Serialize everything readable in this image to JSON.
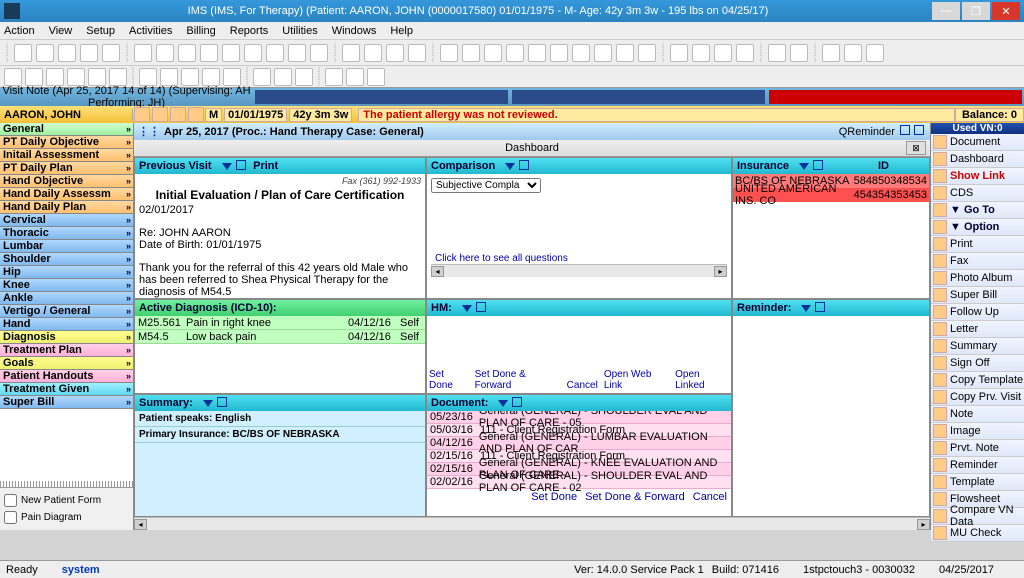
{
  "title": "IMS (IMS, For Therapy)    (Patient: AARON, JOHN  (0000017580) 01/01/1975 - M- Age: 42y 3m 3w - 195 lbs on 04/25/17)",
  "menu": [
    "Action",
    "View",
    "Setup",
    "Activities",
    "Billing",
    "Reports",
    "Utilities",
    "Windows",
    "Help"
  ],
  "visitHeader": "Visit Note (Apr 25, 2017   14 of 14)  (Supervising: AH Performing: JH)",
  "patient": {
    "name": "AARON, JOHN",
    "sex": "M",
    "dob": "01/01/1975",
    "age": "42y 3m 3w",
    "warn": "The patient allergy was not reviewed.",
    "balance": "Balance: 0"
  },
  "leftNav": [
    {
      "l": "General",
      "c": "c-green"
    },
    {
      "l": "PT Daily Objective",
      "c": "c-orange"
    },
    {
      "l": "Initail Assessment",
      "c": "c-orange"
    },
    {
      "l": "PT Daily Plan",
      "c": "c-orange"
    },
    {
      "l": "Hand Objective",
      "c": "c-orange"
    },
    {
      "l": "Hand Daily Assessm",
      "c": "c-orange"
    },
    {
      "l": "Hand Daily Plan",
      "c": "c-orange"
    },
    {
      "l": "Cervical",
      "c": "c-blue"
    },
    {
      "l": "Thoracic",
      "c": "c-blue"
    },
    {
      "l": "Lumbar",
      "c": "c-blue"
    },
    {
      "l": "Shoulder",
      "c": "c-blue"
    },
    {
      "l": "Hip",
      "c": "c-blue"
    },
    {
      "l": "Knee",
      "c": "c-blue"
    },
    {
      "l": "Ankle",
      "c": "c-blue"
    },
    {
      "l": "Vertigo / General",
      "c": "c-blue"
    },
    {
      "l": "Hand",
      "c": "c-blue"
    },
    {
      "l": "Diagnosis",
      "c": "c-yellow"
    },
    {
      "l": "Treatment Plan",
      "c": "c-pink"
    },
    {
      "l": "Goals",
      "c": "c-yellow"
    },
    {
      "l": "Patient Handouts",
      "c": "c-pink"
    },
    {
      "l": "Treatment Given",
      "c": "c-cyan"
    },
    {
      "l": "Super Bill",
      "c": "c-blue"
    }
  ],
  "leftChecks": [
    "New Patient Form",
    "Pain Diagram"
  ],
  "dateline": "Apr 25, 2017  (Proc.: Hand Therapy  Case: General)",
  "qreminder": "QReminder",
  "dashboard": "Dashboard",
  "panels": {
    "prev": {
      "hdr": "Previous Visit",
      "print": "Print",
      "fax": "Fax (361) 992-1933",
      "title": "Initial Evaluation / Plan of Care Certification",
      "date": "02/01/2017",
      "re": "Re: JOHN  AARON",
      "dob": "Date of Birth: 01/01/1975",
      "body": "Thank you for the referral of this 42 years old Male who has been referred to Shea Physical Therapy for the diagnosis of M54.5"
    },
    "cmp": {
      "hdr": "Comparison",
      "opt": "Subjective Compla",
      "link": "Click here to see all questions"
    },
    "ins": {
      "hdr": "Insurance",
      "idhdr": "ID",
      "rows": [
        [
          "BC/BS OF NEBRASKA",
          "584850348534"
        ],
        [
          "UNITED AMERICAN INS. CO",
          "454354353453"
        ]
      ]
    },
    "diag": {
      "hdr": "Active Diagnosis (ICD-10):",
      "rows": [
        [
          "M25.561",
          "Pain in right knee",
          "04/12/16",
          "Self"
        ],
        [
          "M54.5",
          "Low back pain",
          "04/12/16",
          "Self"
        ]
      ]
    },
    "hm": {
      "hdr": "HM:",
      "links": [
        "Set Done",
        "Set Done & Forward",
        "Cancel",
        "Open Web Link",
        "Open Linked"
      ]
    },
    "sum": {
      "hdr": "Summary:",
      "rows": [
        "Patient speaks: English",
        "Primary Insurance:  BC/BS OF NEBRASKA"
      ]
    },
    "doc": {
      "hdr": "Document:",
      "rows": [
        [
          "05/23/16",
          "General (GENERAL)  - SHOULDER EVAL AND PLAN OF CARE - 05"
        ],
        [
          "05/03/16",
          "111 - Client Registration Form"
        ],
        [
          "04/12/16",
          "General (GENERAL)  - LUMBAR EVALUATION AND PLAN OF CAR"
        ],
        [
          "02/15/16",
          "111 - Client Registration Form"
        ],
        [
          "02/15/16",
          "General (GENERAL)  - KNEE EVALUATION AND PLAN OF CARE -"
        ],
        [
          "02/02/16",
          "General (GENERAL)  - SHOULDER EVAL AND PLAN OF CARE - 02"
        ]
      ],
      "links": [
        "Set Done",
        "Set Done & Forward",
        "Cancel"
      ]
    },
    "rem": {
      "hdr": "Reminder:"
    }
  },
  "rightNav": {
    "used": "Used  VN:0",
    "items": [
      {
        "l": "Document"
      },
      {
        "l": "Dashboard"
      },
      {
        "l": "Show Link",
        "red": 1
      },
      {
        "l": "CDS"
      },
      {
        "l": "Go To",
        "b": 1
      },
      {
        "l": "Option",
        "b": 1
      },
      {
        "l": "Print"
      },
      {
        "l": "Fax"
      },
      {
        "l": "Photo Album"
      },
      {
        "l": "Super Bill"
      },
      {
        "l": "Follow Up"
      },
      {
        "l": "Letter"
      },
      {
        "l": "Summary"
      },
      {
        "l": "Sign Off"
      },
      {
        "l": "Copy Template"
      },
      {
        "l": "Copy Prv. Visit"
      },
      {
        "l": "Note"
      },
      {
        "l": "Image"
      },
      {
        "l": "Prvt. Note"
      },
      {
        "l": "Reminder"
      },
      {
        "l": "Template"
      },
      {
        "l": "Flowsheet"
      },
      {
        "l": "Compare VN Data"
      },
      {
        "l": "MU Check"
      }
    ]
  },
  "status": {
    "ready": "Ready",
    "sys": "system",
    "ver": "Ver: 14.0.0 Service Pack 1",
    "build": "Build: 071416",
    "term": "1stpctouch3 - 0030032",
    "date": "04/25/2017"
  }
}
